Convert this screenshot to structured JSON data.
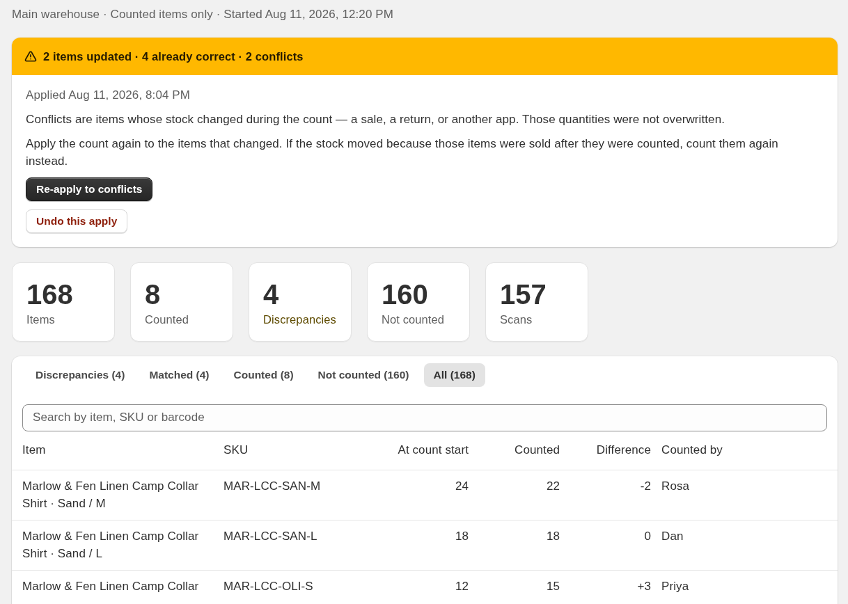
{
  "subtitle": "Main warehouse · Counted items only · Started Aug 11, 2026, 12:20 PM",
  "banner": {
    "kind": "warning",
    "title": "2 items updated · 4 already correct · 2 conflicts",
    "applied": "Applied Aug 11, 2026, 8:04 PM",
    "paragraphs": [
      "Conflicts are items whose stock changed during the count — a sale, a return, or another app. Those quantities were not overwritten.",
      "Apply the count again to the items that changed. If the stock moved because those items were sold after they were counted, count them again instead."
    ],
    "buttons": [
      {
        "label": "Re-apply to conflicts",
        "kind": "primary"
      },
      {
        "label": "Undo this apply",
        "kind": "destructive"
      }
    ]
  },
  "stats": [
    {
      "value": "168",
      "label": "Items",
      "color": "#616161"
    },
    {
      "value": "8",
      "label": "Counted",
      "color": "#616161"
    },
    {
      "value": "4",
      "label": "Discrepancies",
      "color": "#5e4b00"
    },
    {
      "value": "160",
      "label": "Not counted",
      "color": "#616161"
    },
    {
      "value": "157",
      "label": "Scans",
      "color": "#616161"
    }
  ],
  "tabs": [
    {
      "label": "Discrepancies (4)",
      "selected": false
    },
    {
      "label": "Matched (4)",
      "selected": false
    },
    {
      "label": "Counted (8)",
      "selected": false
    },
    {
      "label": "Not counted (160)",
      "selected": false
    },
    {
      "label": "All (168)",
      "selected": true
    }
  ],
  "search": {
    "placeholder": "Search by item, SKU or barcode"
  },
  "table": {
    "columns": [
      {
        "label": "Item",
        "kind": "text"
      },
      {
        "label": "SKU",
        "kind": "text"
      },
      {
        "label": "At count start",
        "kind": "number"
      },
      {
        "label": "Counted",
        "kind": "number"
      },
      {
        "label": "Difference",
        "kind": "number"
      },
      {
        "label": "Counted by",
        "kind": "text"
      }
    ],
    "rows": [
      [
        "Marlow & Fen Linen Camp Collar Shirt · Sand / M",
        "MAR-LCC-SAN-M",
        "24",
        "22",
        "-2",
        "Rosa"
      ],
      [
        "Marlow & Fen Linen Camp Collar Shirt · Sand / L",
        "MAR-LCC-SAN-L",
        "18",
        "18",
        "0",
        "Dan"
      ],
      [
        "Marlow & Fen Linen Camp Collar",
        "MAR-LCC-OLI-S",
        "12",
        "15",
        "+3",
        "Priya"
      ]
    ]
  }
}
